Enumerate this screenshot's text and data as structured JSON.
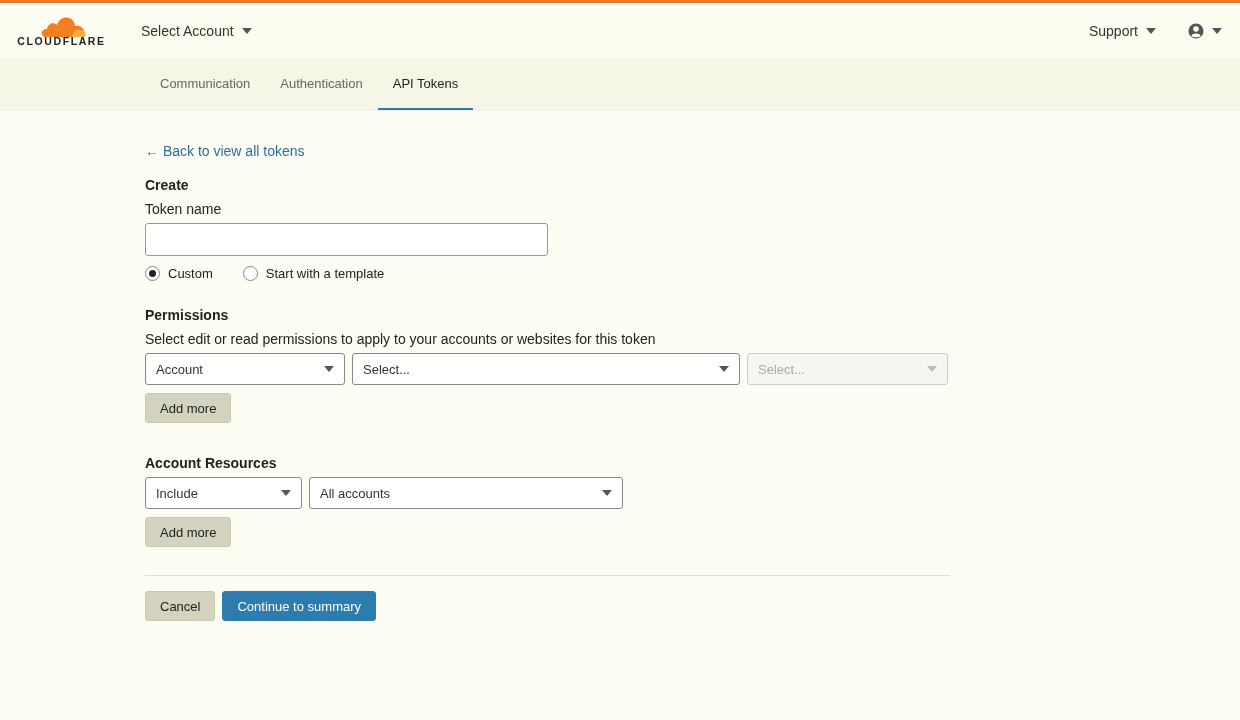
{
  "header": {
    "logo_text": "CLOUDFLARE",
    "account_menu": "Select Account",
    "support_menu": "Support"
  },
  "tabs": [
    {
      "label": "Communication",
      "selected": false
    },
    {
      "label": "Authentication",
      "selected": false
    },
    {
      "label": "API Tokens",
      "selected": true
    }
  ],
  "back_link": "← Back to view all tokens",
  "create": {
    "heading": "Create",
    "token_name_label": "Token name",
    "radios": [
      {
        "label": "Custom",
        "selected": true
      },
      {
        "label": "Start with a template",
        "selected": false
      }
    ]
  },
  "permissions": {
    "heading": "Permissions",
    "description": "Select edit or read permissions to apply to your accounts or websites for this token",
    "selects": [
      {
        "value": "Account",
        "disabled": false
      },
      {
        "placeholder": "Select...",
        "disabled": false
      },
      {
        "placeholder": "Select...",
        "disabled": true
      }
    ],
    "add_more": "Add more"
  },
  "account_resources": {
    "heading": "Account Resources",
    "selects": [
      {
        "value": "Include",
        "disabled": false
      },
      {
        "value": "All accounts",
        "disabled": false
      }
    ],
    "add_more": "Add more"
  },
  "actions": [
    {
      "label": "Cancel",
      "kind": "secondary"
    },
    {
      "label": "Continue to summary",
      "kind": "primary"
    }
  ]
}
